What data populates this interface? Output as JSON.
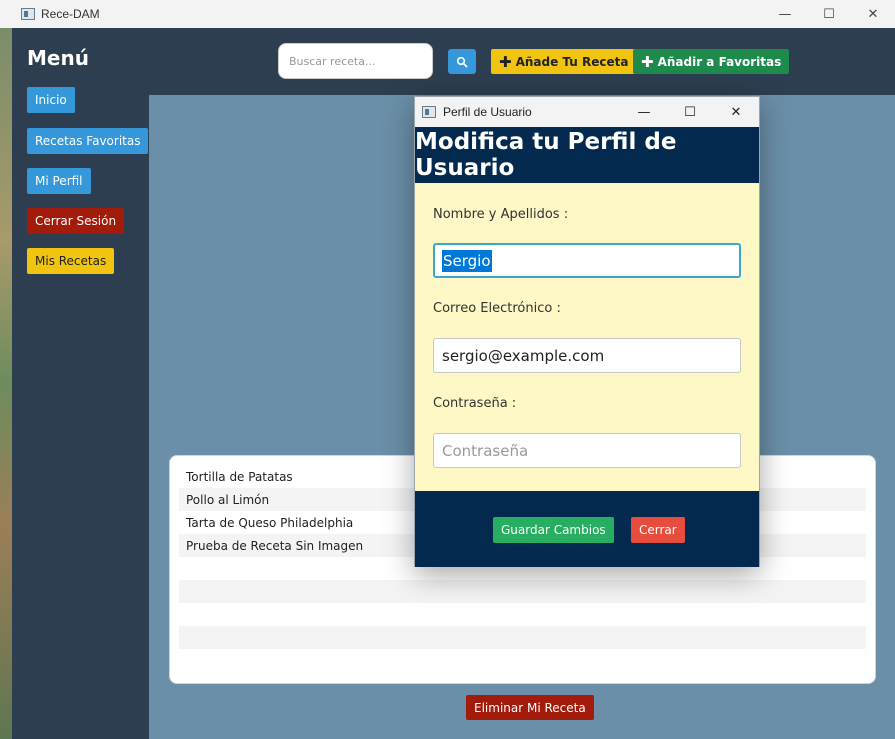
{
  "window": {
    "title": "Rece-DAM",
    "controls": {
      "minimize": "—",
      "maximize": "☐",
      "close": "✕"
    }
  },
  "sidebar": {
    "title": "Menú",
    "items": [
      {
        "label": "Inicio",
        "color": "#3498db"
      },
      {
        "label": "Recetas Favoritas",
        "color": "#3498db"
      },
      {
        "label": "Mi Perfil",
        "color": "#3498db"
      },
      {
        "label": "Cerrar Sesión",
        "color": "#a31b0b"
      },
      {
        "label": "Mis Recetas",
        "color": "#f1c40f"
      }
    ]
  },
  "toolbar": {
    "search_placeholder": "Buscar receta...",
    "search_icon": "search-icon",
    "add_recipe_label": "Añade Tu Receta",
    "add_favorite_label": "Añadir a Favoritas"
  },
  "recipes": [
    "Tortilla de Patatas",
    "Pollo al Limón",
    "Tarta de Queso Philadelphia",
    "Prueba de Receta Sin Imagen"
  ],
  "delete_label": "Eliminar Mi Receta",
  "dialog": {
    "title": "Perfil de Usuario",
    "header": "Modifica tu Perfil de Usuario",
    "name_label": "Nombre y Apellidos :",
    "name_value": "Sergio",
    "email_label": "Correo Electrónico :",
    "email_value": "sergio@example.com",
    "password_label": "Contraseña :",
    "password_placeholder": "Contraseña",
    "save_label": "Guardar Cambios",
    "close_label": "Cerrar"
  },
  "colors": {
    "sidebar_bg": "#2c3e50",
    "content_bg": "#6b8fa8",
    "dialog_header_bg": "#032a4e",
    "dialog_body_bg": "#fdf8c6",
    "accent_blue": "#3498db",
    "accent_yellow": "#f1c40f",
    "accent_green": "#1e8a4c",
    "danger": "#a31b0b"
  }
}
